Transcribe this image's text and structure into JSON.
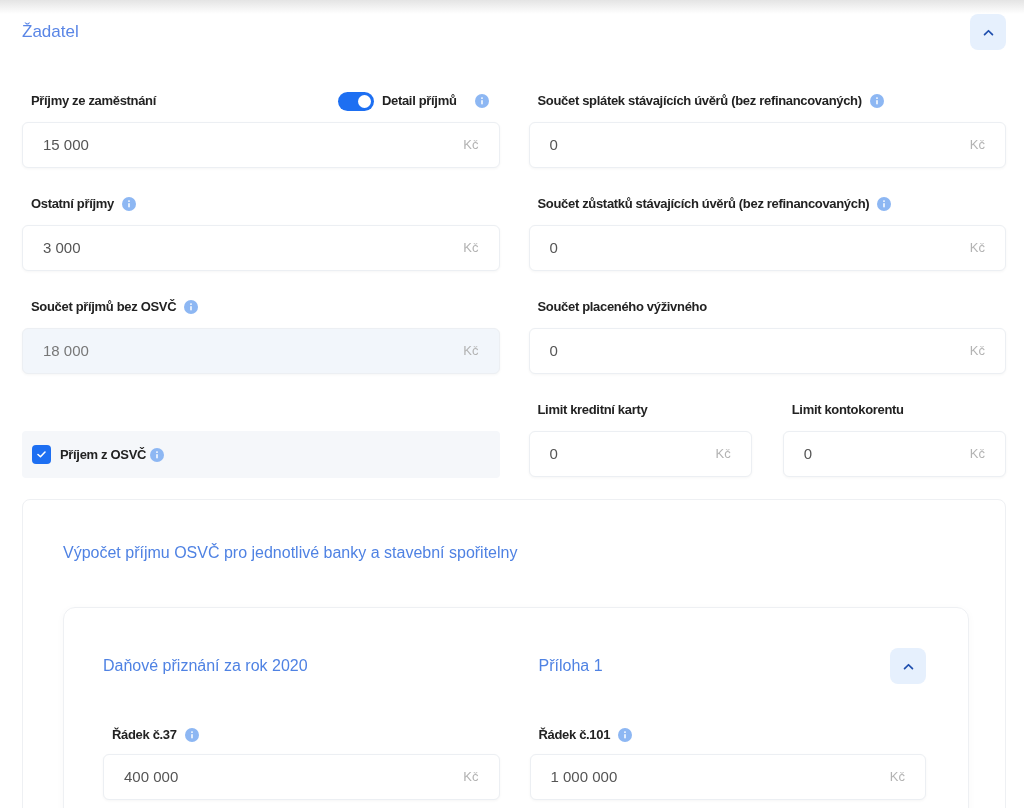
{
  "applicant": {
    "title": "Žadatel",
    "expanded": true,
    "fields": [
      {
        "kind": "field",
        "label": "Příjmy ze zaměstnání",
        "info": false,
        "value": "15 000",
        "unit": "Kč",
        "disabled": false,
        "toggle": {
          "label": "Detail příjmů",
          "on": true,
          "info": true
        }
      },
      {
        "kind": "field",
        "label": "Součet splátek stávajících úvěrů (bez refinancovaných)",
        "info": true,
        "value": "0",
        "unit": "Kč",
        "disabled": false
      },
      {
        "kind": "field",
        "label": "Ostatní příjmy",
        "info": true,
        "value": "3 000",
        "unit": "Kč",
        "disabled": false
      },
      {
        "kind": "field",
        "label": "Součet zůstatků stávajících úvěrů (bez refinancovaných)",
        "info": true,
        "value": "0",
        "unit": "Kč",
        "disabled": false
      },
      {
        "kind": "field",
        "label": "Součet příjmů bez OSVČ",
        "info": true,
        "value": "18 000",
        "unit": "Kč",
        "disabled": true
      },
      {
        "kind": "field",
        "label": "Součet placeného výživného",
        "info": false,
        "value": "0",
        "unit": "Kč",
        "disabled": false
      },
      {
        "kind": "checkbox",
        "label": "Příjem z OSVČ",
        "info": true,
        "checked": true
      },
      {
        "kind": "pair",
        "fields": [
          {
            "label": "Limit kreditní karty",
            "info": false,
            "value": "0",
            "unit": "Kč",
            "disabled": false
          },
          {
            "label": "Limit kontokorentu",
            "info": false,
            "value": "0",
            "unit": "Kč",
            "disabled": false
          }
        ]
      }
    ]
  },
  "osvc": {
    "title": "Výpočet příjmu OSVČ pro jednotlivé banky a stavební spořitelny",
    "tax_return": {
      "title": "Daňové přiznání za rok 2020",
      "attachment": "Příloha 1",
      "expanded": true,
      "fields": [
        {
          "label": "Řádek č.37",
          "info": true,
          "value": "400 000",
          "unit": "Kč",
          "disabled": false
        },
        {
          "label": "Řádek č.101",
          "info": true,
          "value": "1 000 000",
          "unit": "Kč",
          "disabled": false
        }
      ]
    }
  }
}
